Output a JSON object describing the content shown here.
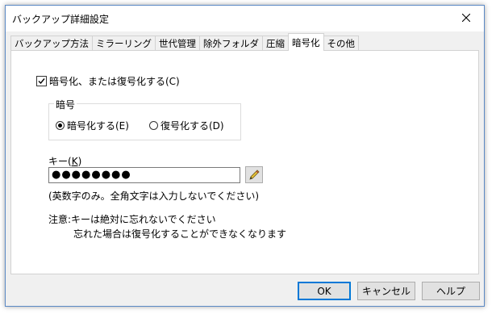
{
  "window": {
    "title": "バックアップ詳細設定",
    "close_label": "×"
  },
  "tabs": [
    {
      "label": "バックアップ方法"
    },
    {
      "label": "ミラーリング"
    },
    {
      "label": "世代管理"
    },
    {
      "label": "除外フォルダ"
    },
    {
      "label": "圧縮"
    },
    {
      "label": "暗号化",
      "active": true
    },
    {
      "label": "その他"
    }
  ],
  "encryption": {
    "enable_label": "暗号化、または復号化する(C)",
    "enable_checked": true,
    "group_label": "暗号",
    "mode_options": [
      {
        "label": "暗号化する(E)",
        "selected": true
      },
      {
        "label": "復号化する(D)",
        "selected": false
      }
    ],
    "key_label_prefix": "キー(",
    "key_label_accel": "K",
    "key_label_suffix": ")",
    "key_value": "●●●●●●●●",
    "key_hint": "(英数字のみ。全角文字は入力しないでください)",
    "note_line1": "注意:キーは絶対に忘れないでください",
    "note_line2": "忘れた場合は復号化することができなくなります"
  },
  "buttons": {
    "ok": "OK",
    "cancel": "キャンセル",
    "help": "ヘルプ"
  },
  "colors": {
    "accent": "#0078d7",
    "window_border": "#5b89c5"
  }
}
